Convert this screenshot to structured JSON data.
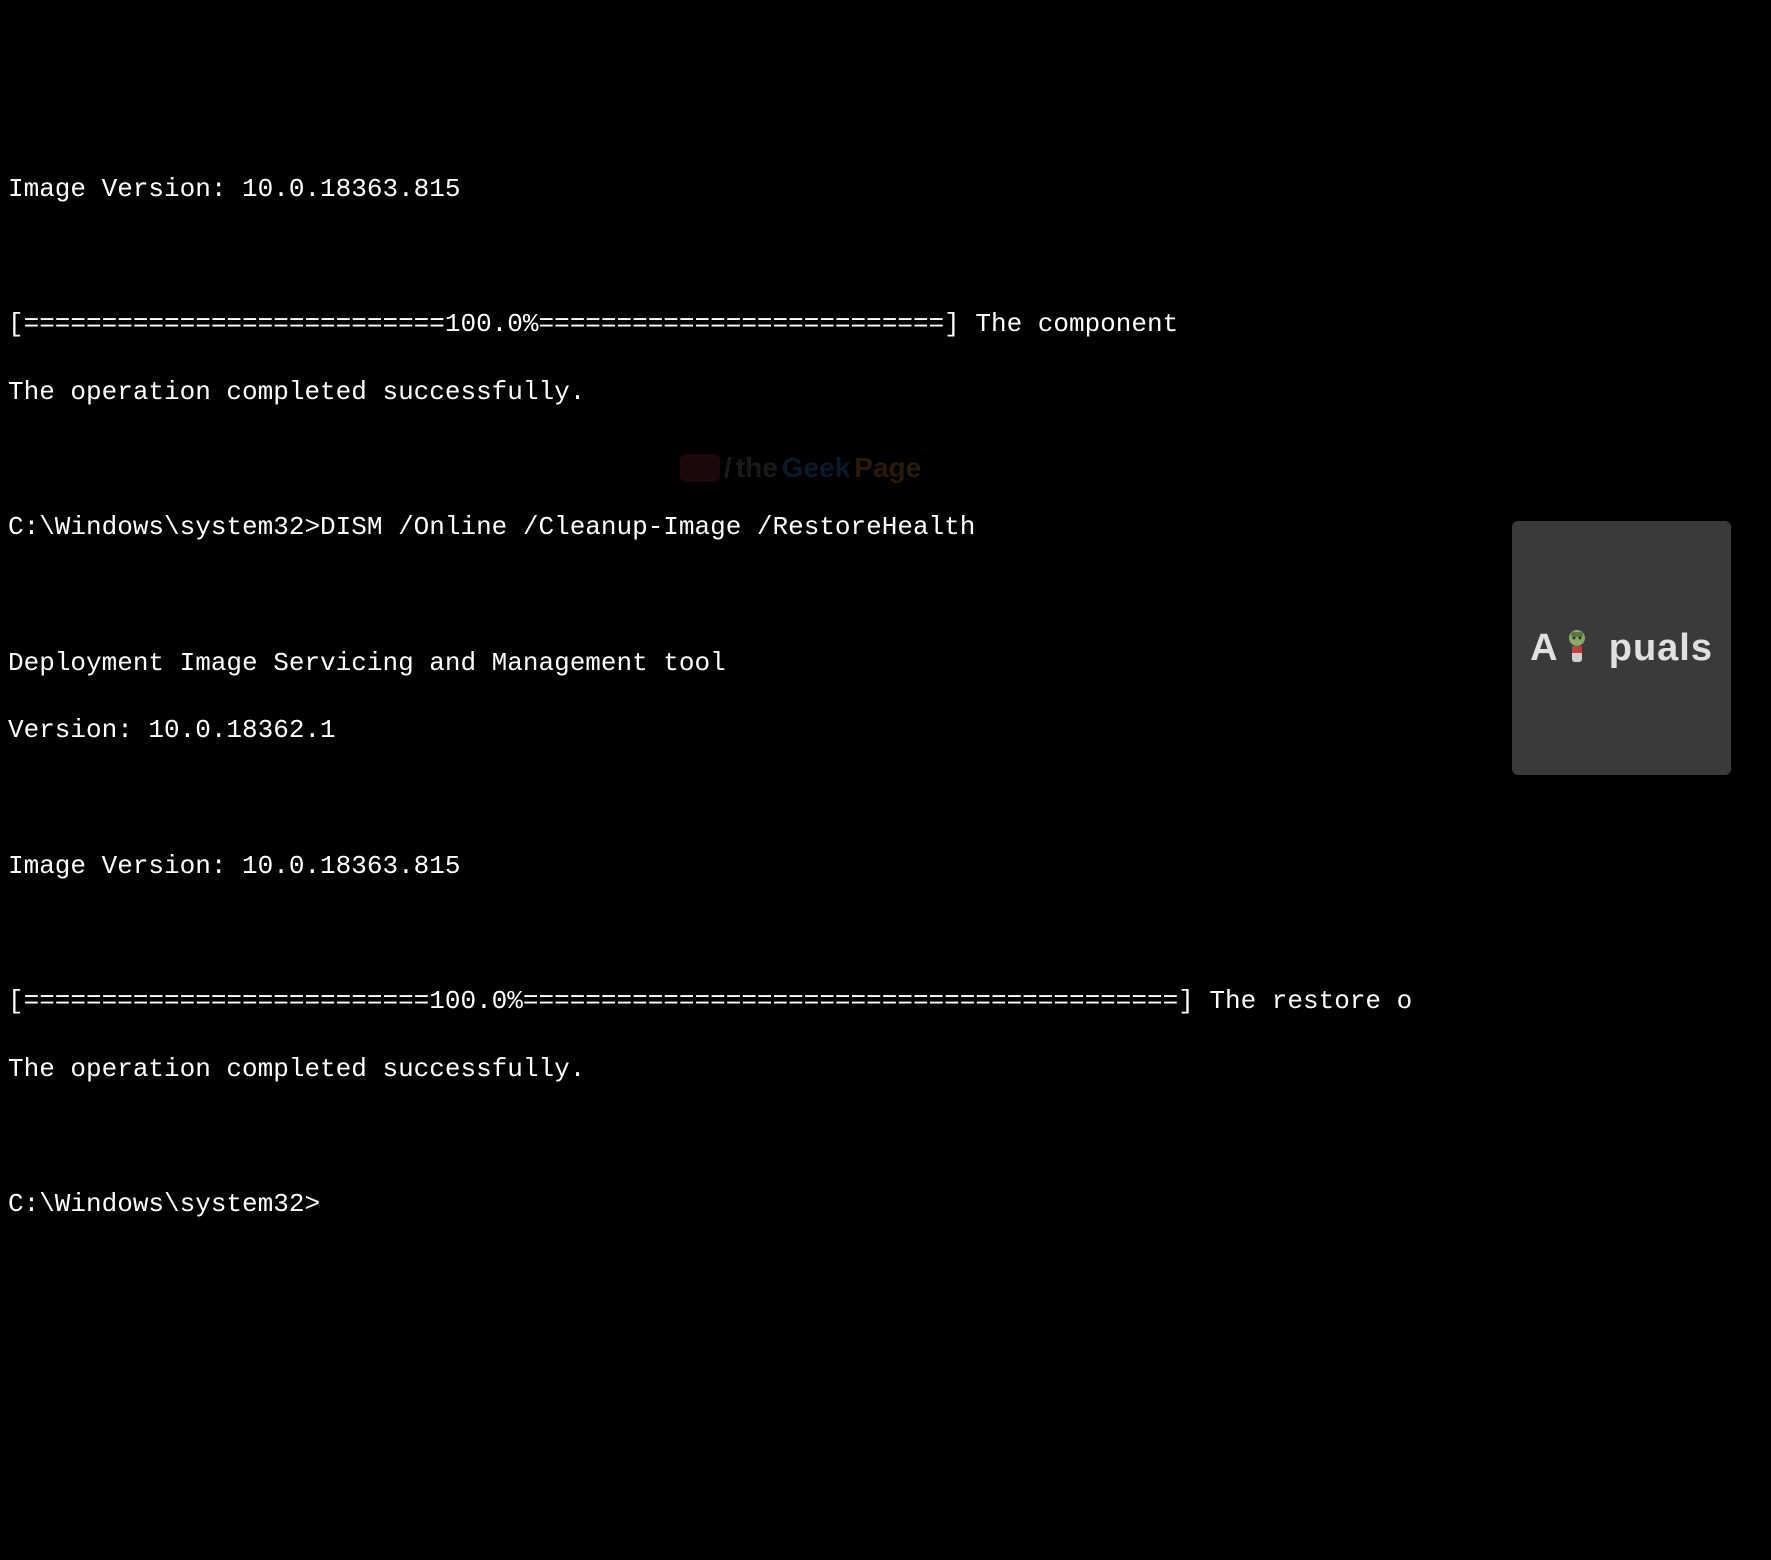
{
  "terminal": {
    "lines": [
      "Image Version: 10.0.18363.815",
      "",
      "[===========================100.0%==========================] The component",
      "The operation completed successfully.",
      "",
      "C:\\Windows\\system32>DISM /Online /Cleanup-Image /RestoreHealth",
      "",
      "Deployment Image Servicing and Management tool",
      "Version: 10.0.18362.1",
      "",
      "Image Version: 10.0.18363.815",
      "",
      "[==========================100.0%==========================================] The restore o",
      "The operation completed successfully.",
      "",
      "C:\\Windows\\system32>"
    ]
  },
  "watermark": {
    "the": "the",
    "geek": "Geek",
    "page": "Page"
  },
  "logo": {
    "prefix": "A",
    "suffix": "puals"
  }
}
